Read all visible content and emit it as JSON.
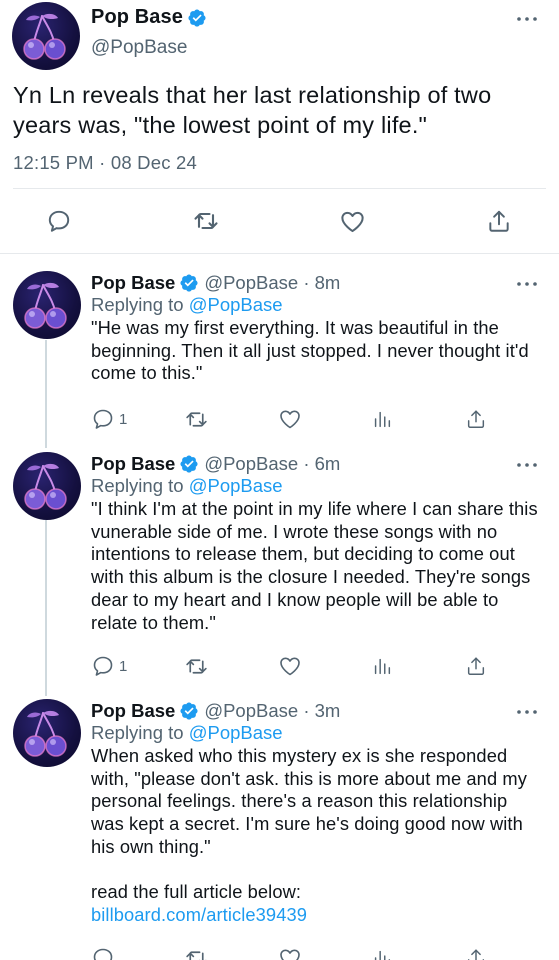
{
  "main_tweet": {
    "display_name": "Pop Base",
    "handle": "@PopBase",
    "text": "Yn Ln reveals that her last relationship of two years was, \"the lowest point of my life.\"",
    "timestamp": "12:15 PM · 08 Dec 24"
  },
  "replies": [
    {
      "display_name": "Pop Base",
      "handle_time": "@PopBase · 8m",
      "replying_prefix": "Replying to",
      "replying_to": "@PopBase",
      "text": "\"He was my first everything. It was beautiful in the beginning. Then it all just stopped. I never thought it'd come to this.\"",
      "reply_count": "1"
    },
    {
      "display_name": "Pop Base",
      "handle_time": "@PopBase · 6m",
      "replying_prefix": "Replying to",
      "replying_to": "@PopBase",
      "text": "\"I think I'm at the point in my life where I can share this vunerable side of me. I wrote these songs with no intentions to release them, but deciding to come out with this album is the closure I needed. They're songs dear to my heart and I know people will be able to relate to them.\"",
      "reply_count": "1"
    },
    {
      "display_name": "Pop Base",
      "handle_time": "@PopBase · 3m",
      "replying_prefix": "Replying to",
      "replying_to": "@PopBase",
      "text": "When asked who this mystery ex is she responded with, \"please don't ask. this is more about me and my personal feelings. there's a reason this relationship was kept a secret. I'm sure he's doing good now with his own thing.\"",
      "text_2": "read the full article below:",
      "link": "billboard.com/article39439",
      "reply_count": ""
    }
  ],
  "icons": {
    "verified": "verified-badge-icon",
    "reply": "reply-bubble-icon",
    "retweet": "retweet-icon",
    "like": "heart-icon",
    "share": "share-icon",
    "analytics": "analytics-icon",
    "more": "more-dots-icon"
  },
  "colors": {
    "accent": "#1d9bf0",
    "secondary_text": "#536471",
    "primary_text": "#0f1419",
    "divider": "#e6e9ec",
    "thread_line": "#cfd9de"
  }
}
